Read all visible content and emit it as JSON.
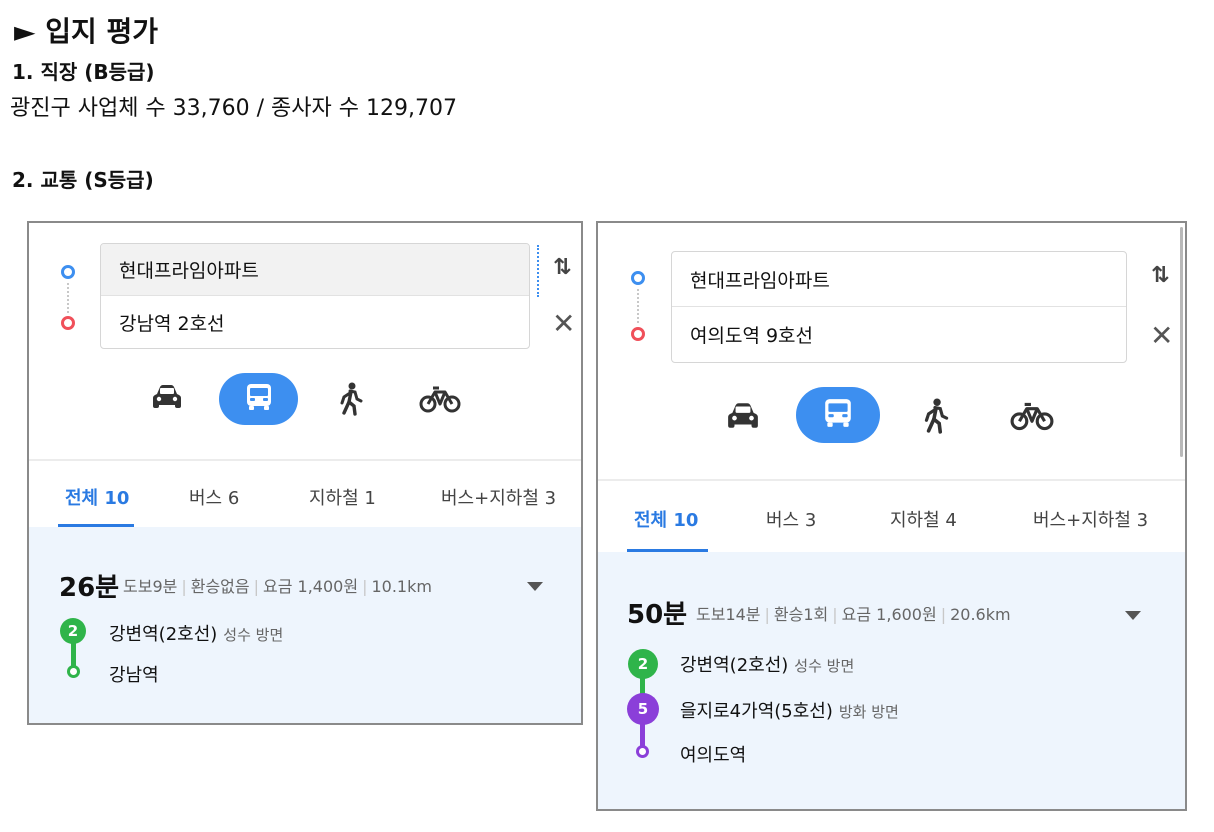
{
  "page": {
    "heading": "► 입지 평가",
    "section1_title": "1. 직장 (B등급)",
    "section1_text": "광진구 사업체 수 33,760 / 종사자 수 129,707",
    "section2_title": "2. 교통 (S등급)"
  },
  "route1": {
    "origin": "현대프라임아파트",
    "destination": "강남역 2호선",
    "tabs": [
      "전체 10",
      "버스 6",
      "지하철 1",
      "버스+지하철 3"
    ],
    "time": "26분",
    "walk": "도보9분",
    "transfer": "환승없음",
    "fare": "요금 1,400원",
    "distance": "10.1km",
    "legs": [
      {
        "badge": "2",
        "station": "강변역(2호선)",
        "direction": "성수 방면",
        "color": "#2fb44a"
      }
    ],
    "final_stop": "강남역"
  },
  "route2": {
    "origin": "현대프라임아파트",
    "destination": "여의도역 9호선",
    "tabs": [
      "전체 10",
      "버스 3",
      "지하철 4",
      "버스+지하철 3"
    ],
    "time": "50분",
    "walk": "도보14분",
    "transfer": "환승1회",
    "fare": "요금 1,600원",
    "distance": "20.6km",
    "legs": [
      {
        "badge": "2",
        "station": "강변역(2호선)",
        "direction": "성수 방면",
        "color": "#2fb44a"
      },
      {
        "badge": "5",
        "station": "을지로4가역(5호선)",
        "direction": "방화 방면",
        "color": "#8b3fd9"
      }
    ],
    "final_stop": "여의도역"
  },
  "icons": [
    "swap-icon",
    "close-icon",
    "car-icon",
    "bus-icon",
    "walk-icon",
    "bike-icon",
    "caret-down-icon"
  ],
  "colors": {
    "accent": "#3d8ff0",
    "tab_active": "#2a7ae2",
    "origin": "#3d8ff0",
    "destination": "#f0505a",
    "result_bg": "#eef5fd"
  }
}
